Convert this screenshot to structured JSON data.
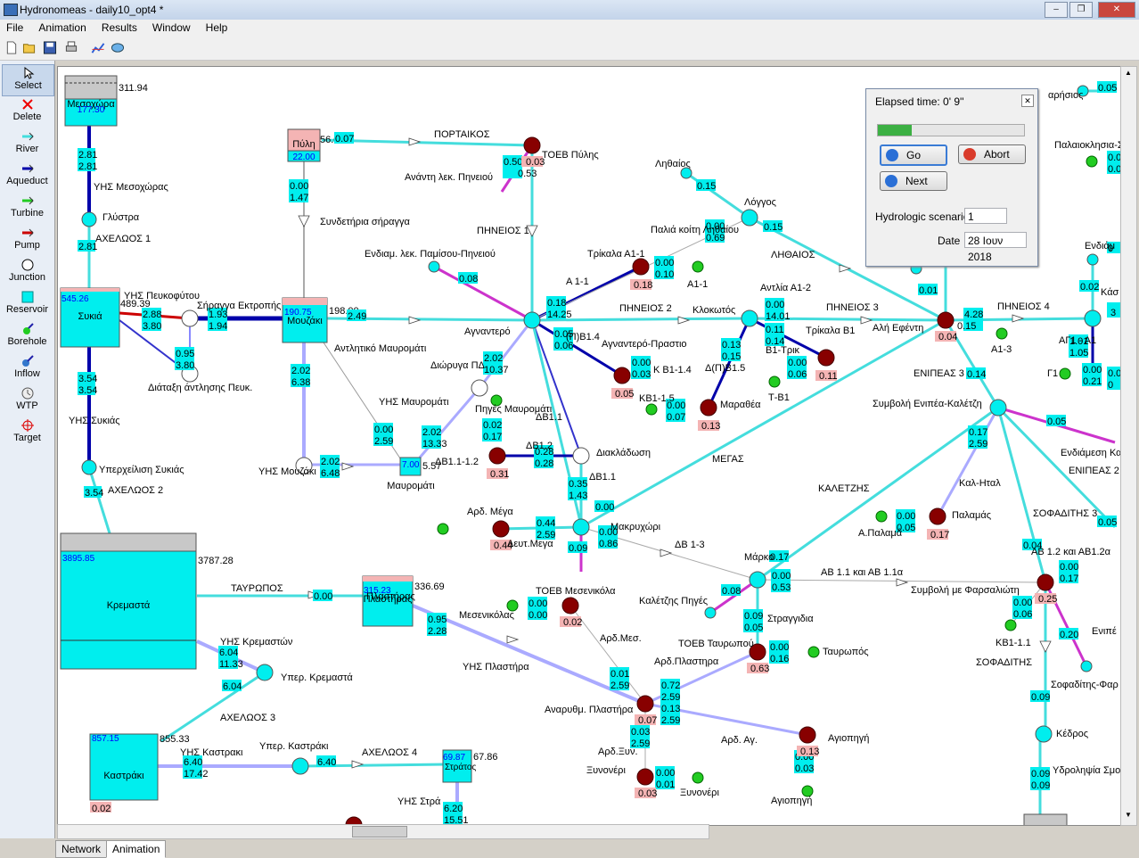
{
  "window": {
    "title": "Hydronomeas - daily10_opt4 *",
    "buttons": [
      "minimize",
      "restore",
      "close"
    ]
  },
  "menu": [
    "File",
    "Animation",
    "Results",
    "Window",
    "Help"
  ],
  "toolbar": {
    "icons": [
      "new-icon",
      "open-icon",
      "save-icon",
      "print-icon",
      "chart-icon",
      "network-icon"
    ]
  },
  "palette": [
    {
      "label": "Select",
      "icon": "cursor-icon"
    },
    {
      "label": "Delete",
      "icon": "delete-icon"
    },
    {
      "label": "River",
      "icon": "river-icon"
    },
    {
      "label": "Aqueduct",
      "icon": "aqueduct-icon"
    },
    {
      "label": "Turbine",
      "icon": "turbine-icon"
    },
    {
      "label": "Pump",
      "icon": "pump-icon"
    },
    {
      "label": "Junction",
      "icon": "junction-icon"
    },
    {
      "label": "Reservoir",
      "icon": "reservoir-icon"
    },
    {
      "label": "Borehole",
      "icon": "borehole-icon"
    },
    {
      "label": "Inflow",
      "icon": "inflow-icon"
    },
    {
      "label": "WTP",
      "icon": "wtp-icon"
    },
    {
      "label": "Target",
      "icon": "target-icon"
    }
  ],
  "tabs": [
    "Network",
    "Animation"
  ],
  "dialog": {
    "elapsed": "Elapsed time:  0' 9''",
    "progress": 0.23,
    "go": "Go",
    "abort": "Abort",
    "next": "Next",
    "scenario_label": "Hydrologic scenario",
    "scenario_value": "1",
    "date_label": "Date",
    "date_value": "28 Ιουν 2018"
  },
  "colors": {
    "river": "#44dddd",
    "aqueduct": "#0000aa",
    "turbine": "#3333cc",
    "pump": "#cc0000",
    "node": "#00e5ff",
    "target": "#800000",
    "inflow": "#22cc22",
    "target_label": "#f4b4b4"
  },
  "network": {
    "reservoirs": [
      {
        "name": "Μεσοχώρα",
        "value": "311.94",
        "level": "177.30"
      },
      {
        "name": "Πύλη",
        "value": "56.0",
        "level": "22.00"
      },
      {
        "name": "Συκιά",
        "value": "489.39",
        "level": "545.26"
      },
      {
        "name": "Μουζάκι",
        "value": "198.00",
        "level": "190.75"
      },
      {
        "name": "Μαυρομάτι",
        "value": "5.57",
        "level": "7.00"
      },
      {
        "name": "Κρεμαστά",
        "value": "3787.28",
        "level": "3895.85"
      },
      {
        "name": "Πλαστήρας",
        "value": "336.69",
        "level": "315.23"
      },
      {
        "name": "Καστράκι",
        "value": "855.33",
        "level": "857.15",
        "extra": "0.02"
      },
      {
        "name": "Στράτος",
        "value": "67.86",
        "level": "69.87"
      }
    ],
    "labels": [
      "ΥΗΣ Μεσοχώρας",
      "Γλύστρα",
      "ΑΧΕΛΩΟΣ 1",
      "ΥΗΣ Πευκοφύτου",
      "Σήραγγα Εκτροπής",
      "Διάταξη άντλησης Πευκ.",
      "ΥΗΣ Συκιάς",
      "Υπερχείλιση Συκιάς",
      "ΑΧΕΛΩΟΣ 2",
      "ΤΑΥΡΩΠΟΣ",
      "ΥΗΣ Κρεμαστών",
      "Υπερ. Κρεμαστά",
      "ΑΧΕΛΩΟΣ 3",
      "ΥΗΣ Καστρακι",
      "Υπερ. Καστράκι",
      "ΑΧΕΛΩΟΣ 4",
      "ΥΗΣ Στρά",
      "Συνδετήρια σήραγγα",
      "ΠΟΡΤΑΙΚΟΣ",
      "ΤΟΕΒ Πύλης",
      "Ανάντη λεκ. Πηνειού",
      "ΠΗΝΕΙΟΣ 1",
      "Ενδιαμ. λεκ. Παμίσου-Πηνειού",
      "Αντλητικό Μαυρομάτι",
      "ΥΗΣ Μαυρομάτι",
      "Διώρυγα ΠΔ",
      "Πηγές Μαυρομάτι",
      "ΥΗΣ Μουζάκι",
      "Αγναντερό",
      "(Π)Β1.4",
      "Αγναντερό-Πραστιο",
      "Κ Β1-1.4",
      "ΔΒ1.1",
      "ΔΒ1.2",
      "ΔΒ1.1-1.2",
      "Διακλάδωση",
      "ΔΒ1.1",
      "ΚΒ1-1.5",
      "Τρίκαλα Α1-1",
      "Α 1-1",
      "Α1-1",
      "Παλιά κοίτη Ληθαίου",
      "Ληθαίος",
      "Λόγγος",
      "ΠΗΝΕΙΟΣ 2",
      "Κλοκωτός",
      "Δ(Π)Β1.5",
      "Μαραθέα",
      "Τ-Β1",
      "Β1-Τρικ",
      "Τρίκαλα Β1",
      "Αντλία Α1-2",
      "ΠΗΝΕΙΟΣ 3",
      "ΛΗΘΑΙΟΣ",
      "Αλή Εφέντη",
      "Α1-3",
      "ΠΗΝΕΙΟΣ 4",
      "ΑΓ1 - Α1",
      "Γ1",
      "ΕΝΙΠΕΑΣ 3",
      "Συμβολή Ενιπέα-Καλέτζη",
      "Ενδιάμεση Κα",
      "ΕΝΙΠΕΑΣ 2",
      "Καλ-Ηταλ",
      "Παλαμάς",
      "Α.Παλαμά",
      "ΚΑΛΕΤΖΗΣ",
      "ΣΟΦΑΔΙΤΗΣ 3",
      "ΜΕΓΑΣ",
      "Αρδ. Μέγα",
      "Δευτ.Μεγα",
      "Μακρυχώρι",
      "ΔΒ 1-3",
      "Μάρκο",
      "Καλέτζης Πηγές",
      "ΑΒ 1.1 και ΑΒ 1.1α",
      "Συμβολή με Φαρσαλιώτη",
      "ΑΒ 1.2 και ΑΒ1.2α",
      "ΤΟΕΒ Μεσενικόλα",
      "Μεσενικόλας",
      "ΥΗΣ Πλαστήρα",
      "Αρδ.Μεσ.",
      "Στραγγιδια",
      "ΤΟΕΒ Ταυρωπού",
      "Ταυρωπός",
      "Αρδ.Πλαστηρα",
      "Αναρυθμ. Πλαστήρα",
      "Αρδ. Αγ.",
      "Αγιοπηγή",
      "Αρδ.Ξυν.",
      "Ξυνονέρι",
      "ΚΒ1-1.1",
      "ΣΟΦΑΔΙΤΗΣ",
      "Κέδρος",
      "Σοφαδίτης-Φαρ",
      "Υδροληψία Σμο",
      "Ενιπέ",
      "αρήσιος",
      "Παλαιοκλησια-Σ",
      "Ενδιάμ",
      "Κάσ"
    ]
  }
}
